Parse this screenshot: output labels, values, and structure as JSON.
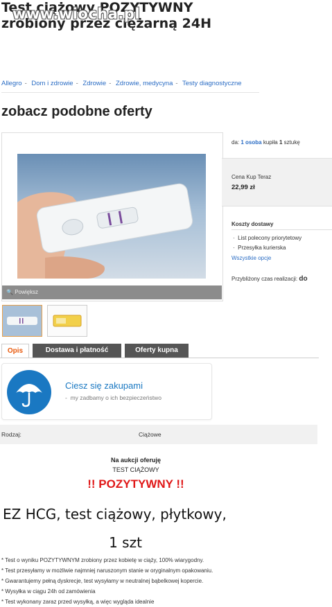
{
  "headline": {
    "line1": "Test ciążowy POZYTYWNY",
    "line2": "zrobiony przez ciężarną 24H"
  },
  "watermark": "www.wiocha.pl",
  "breadcrumb": [
    "Allegro",
    "Dom i zdrowie",
    "Zdrowie",
    "Zdrowie, medycyna",
    "Testy diagnostyczne"
  ],
  "similar_title": "zobacz podobne oferty",
  "gallery": {
    "zoom_label": "Powiększ"
  },
  "stats": {
    "prefix": "da:",
    "count": "1 osoba",
    "suffix_text": "kupiła",
    "qty": "1",
    "unit": "sztukę"
  },
  "price": {
    "label": "Cena Kup Teraz",
    "value": "22,99 zł"
  },
  "shipping": {
    "label": "Koszty dostawy",
    "options": [
      "List polecony priorytetowy",
      "Przesyłka kurierska"
    ],
    "all_link": "Wszystkie opcje"
  },
  "realization": {
    "label": "Przybliżony czas realizacji:",
    "value": "do"
  },
  "tabs": [
    "Opis",
    "Dostawa i płatność",
    "Oferty kupna"
  ],
  "promo": {
    "title": "Ciesz się zakupami",
    "subtitle": "my zadbamy o ich bezpieczeństwo",
    "dash": "-"
  },
  "param": {
    "label": "Rodzaj:",
    "value": "Ciążowe"
  },
  "description": {
    "line1": "Na aukcji oferuję",
    "line2": "TEST CIĄŻOWY",
    "positive": "!! POZYTYWNY !!",
    "product": "EZ HCG, test ciążowy, płytkowy,",
    "qty": "1 szt",
    "bullets": [
      "* Test o wyniku POZYTYWNYM zrobiony przez kobietę w ciąży, 100% wiarygodny.",
      "* Test przesyłamy w możliwie najmniej naruszonym stanie w oryginalnym opakowaniu.",
      "* Gwarantujemy pełną dyskrecje, test wysyłamy w neutralnej bąbelkowej kopercie.",
      "* Wysyłka w ciągu 24h od zamówienia",
      "* Test wykonany zaraz przed wysyłką, a więc wygląda idealnie"
    ]
  },
  "colors": {
    "link": "#2a6cc4",
    "accent_orange": "#e8590c",
    "positive_red": "#e01818",
    "promo_blue": "#1a78c2"
  }
}
